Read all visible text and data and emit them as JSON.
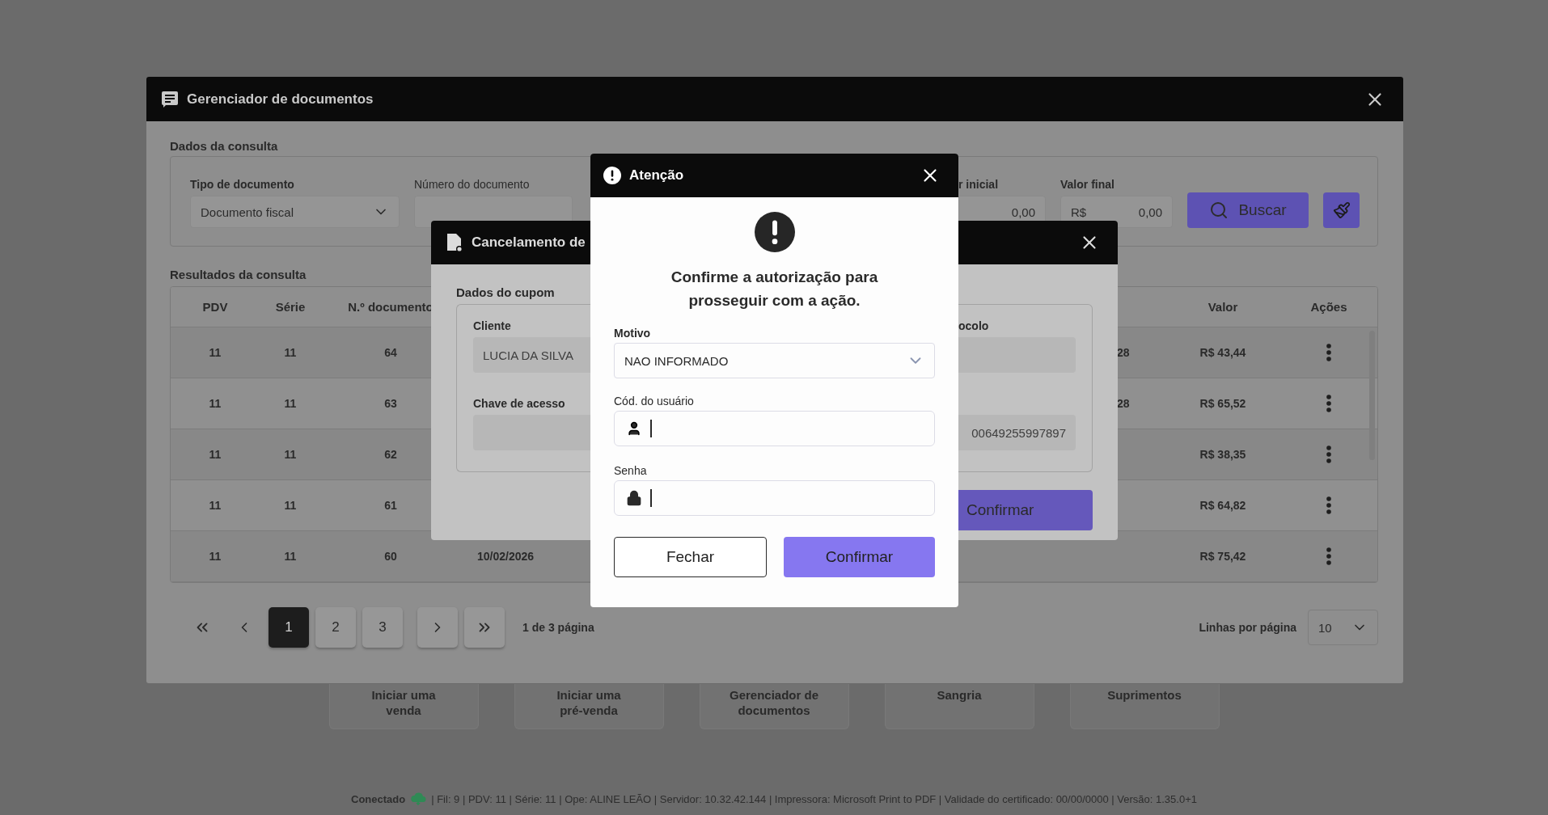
{
  "home": {
    "tiles": [
      {
        "label": "Iniciar uma\nvenda"
      },
      {
        "label": "Iniciar uma\npré-venda"
      },
      {
        "label": "Gerenciador de\ndocumentos"
      },
      {
        "label": "Sangria"
      },
      {
        "label": "Suprimentos"
      }
    ],
    "status_bar": {
      "connection": "Conectado",
      "details": "| Fil: 9 | PDV: 11 | Série: 11 | Ope: ALINE LEÃO | Servidor: 10.32.42.144 | Impressora: Microsoft Print to PDF | Validade do certificado: 00/00/0000 | Versão: 1.35.0+1"
    }
  },
  "document_manager": {
    "title": "Gerenciador de documentos",
    "query": {
      "section_title": "Dados da consulta",
      "document_type": {
        "label": "Tipo de documento",
        "value": "Documento fiscal"
      },
      "document_number": {
        "label": "Número do documento"
      },
      "initial_value": {
        "label": "r inicial",
        "value": "0,00"
      },
      "final_value": {
        "label": "Valor final",
        "currency": "R$",
        "value": "0,00"
      },
      "search_button": "Buscar"
    },
    "results": {
      "section_title": "Resultados da consulta",
      "columns": [
        "PDV",
        "Série",
        "N.º documento",
        "Valor",
        "Ações"
      ],
      "rows": [
        {
          "pdv": "11",
          "serie": "11",
          "numero": "64",
          "column_5": "28",
          "valor": "R$ 43,44"
        },
        {
          "pdv": "11",
          "serie": "11",
          "numero": "63",
          "column_5": "28",
          "valor": "R$ 65,52"
        },
        {
          "pdv": "11",
          "serie": "11",
          "numero": "62",
          "valor": "R$ 38,35"
        },
        {
          "pdv": "11",
          "serie": "11",
          "numero": "61",
          "valor": "R$ 64,82"
        },
        {
          "pdv": "11",
          "serie": "11",
          "numero": "60",
          "column_4": "10/02/2026",
          "valor": "R$ 75,42"
        }
      ]
    },
    "pagination": {
      "pages": [
        {
          "label": "1",
          "selected": true
        },
        {
          "label": "2",
          "selected": false
        },
        {
          "label": "3",
          "selected": false
        }
      ],
      "summary": "1 de 3 página",
      "rows_per_page": {
        "label": "Linhas por página",
        "value": "10"
      }
    }
  },
  "cancel_dialog": {
    "title": "Cancelamento de",
    "section_title": "Dados do cupom",
    "client": {
      "label": "Cliente",
      "value": "LUCIA DA SILVA"
    },
    "access_key": {
      "label": "Chave de acesso",
      "value": "00649255997897"
    },
    "protocol": {
      "label": "ocolo"
    },
    "confirm_button": "Confirmar"
  },
  "attention_dialog": {
    "title": "Atenção",
    "message": "Confirme a autorização para prosseguir com a ação.",
    "reason": {
      "label": "Motivo",
      "value": "NAO INFORMADO"
    },
    "user_code": {
      "label": "Cód. do usuário"
    },
    "password": {
      "label": "Senha"
    },
    "buttons": [
      {
        "label": "Fechar",
        "kind": "secondary"
      },
      {
        "label": "Confirmar",
        "kind": "primary"
      }
    ]
  }
}
